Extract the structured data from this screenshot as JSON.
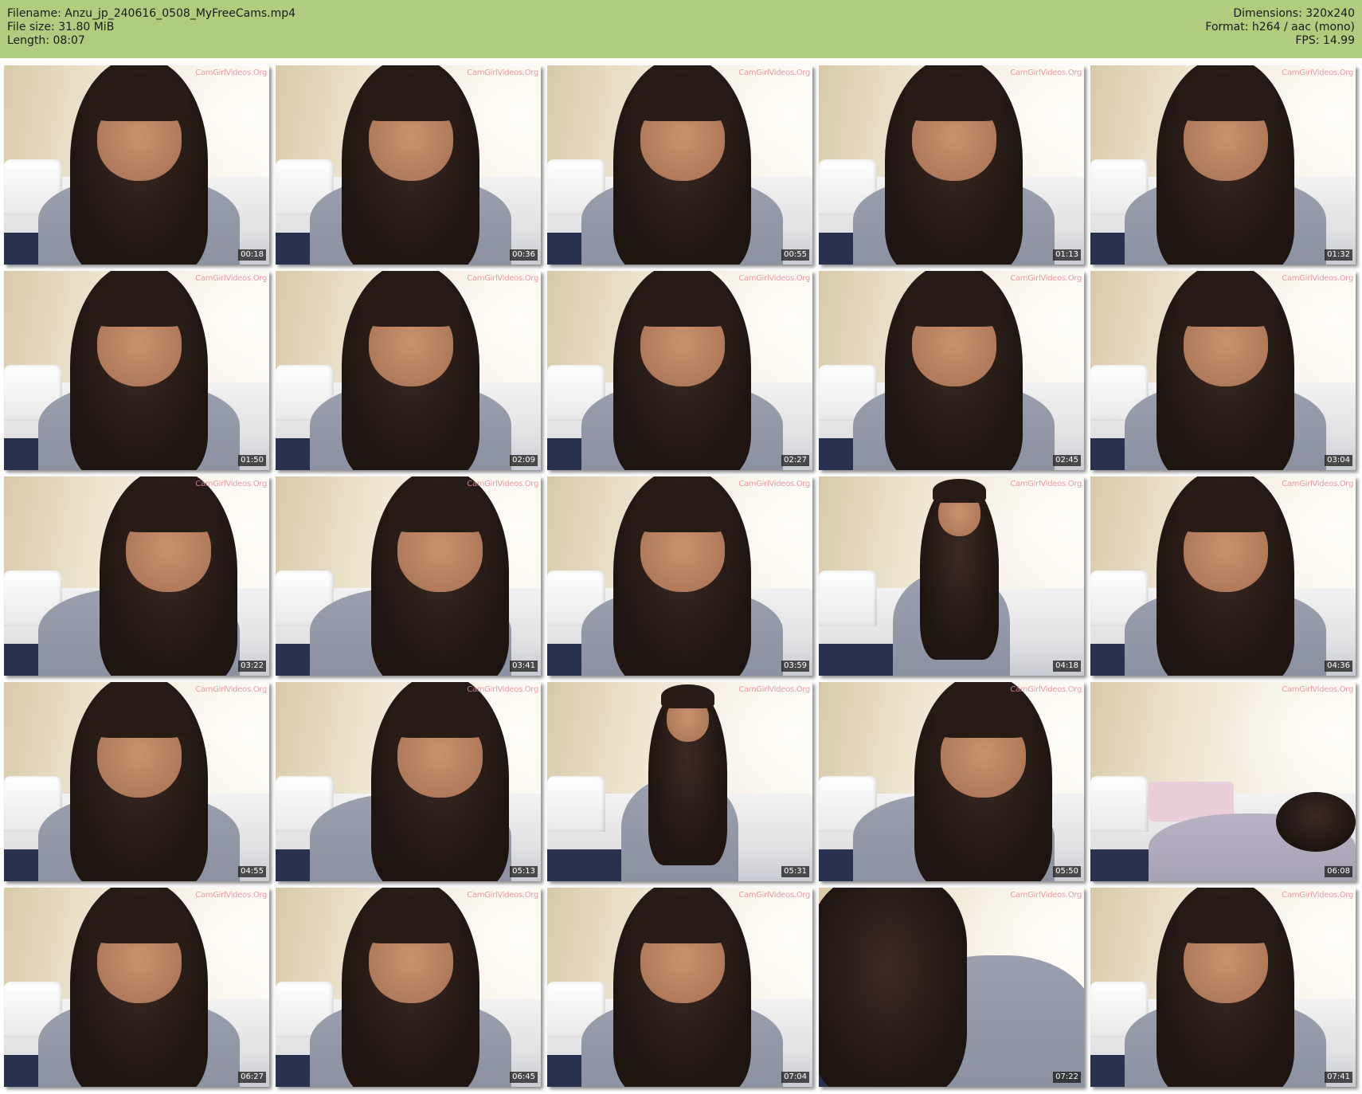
{
  "header": {
    "filename": "Filename: Anzu_jp_240616_0508_MyFreeCams.mp4",
    "file_size": "File size: 31.80 MiB",
    "length": "Length: 08:07",
    "dimensions": "Dimensions: 320x240",
    "format": "Format: h264 / aac (mono)",
    "fps": "FPS: 14.99",
    "background_color": "#b0cd7f"
  },
  "watermark": "CamGirlVideos.Org",
  "thumbnails": [
    {
      "time": "00:18",
      "pose": "center"
    },
    {
      "time": "00:36",
      "pose": "center"
    },
    {
      "time": "00:55",
      "pose": "center"
    },
    {
      "time": "01:13",
      "pose": "center"
    },
    {
      "time": "01:32",
      "pose": "center"
    },
    {
      "time": "01:50",
      "pose": "center"
    },
    {
      "time": "02:09",
      "pose": "center"
    },
    {
      "time": "02:27",
      "pose": "center"
    },
    {
      "time": "02:45",
      "pose": "center"
    },
    {
      "time": "03:04",
      "pose": "center"
    },
    {
      "time": "03:22",
      "pose": "lean"
    },
    {
      "time": "03:41",
      "pose": "lean"
    },
    {
      "time": "03:59",
      "pose": "center"
    },
    {
      "time": "04:18",
      "pose": "far"
    },
    {
      "time": "04:36",
      "pose": "center"
    },
    {
      "time": "04:55",
      "pose": "center"
    },
    {
      "time": "05:13",
      "pose": "lean"
    },
    {
      "time": "05:31",
      "pose": "far"
    },
    {
      "time": "05:50",
      "pose": "lean"
    },
    {
      "time": "06:08",
      "pose": "empty"
    },
    {
      "time": "06:27",
      "pose": "center"
    },
    {
      "time": "06:45",
      "pose": "center"
    },
    {
      "time": "07:04",
      "pose": "center"
    },
    {
      "time": "07:22",
      "pose": "close"
    },
    {
      "time": "07:41",
      "pose": "center"
    }
  ]
}
